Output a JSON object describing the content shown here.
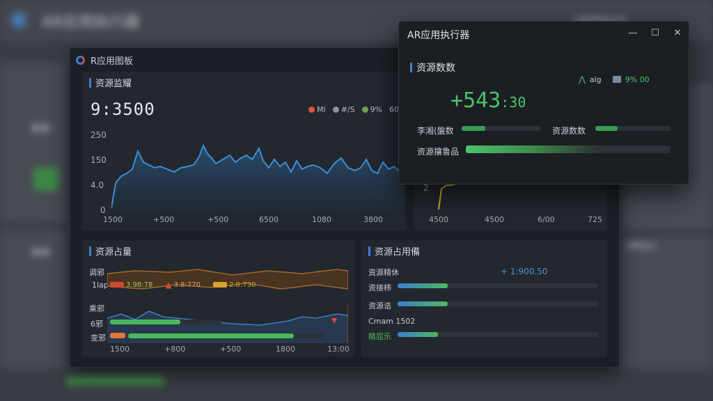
{
  "background": {
    "app_title": "AR应用执行器",
    "right_label": "l4BB8m0",
    "side_label_1": "量量",
    "side_label_2": "量量",
    "right_text": "H8Sa•"
  },
  "dashboard": {
    "title": "R应用图板",
    "monitor": {
      "title": "资源监耀",
      "value": "9:3500",
      "legend": [
        {
          "label": "Ml",
          "color": "#e0553c"
        },
        {
          "label": "#/S",
          "color": "#8e949c"
        },
        {
          "label": "9%",
          "color": "#6aa84f"
        },
        {
          "label": "60",
          "color": "#b0b4ba"
        }
      ],
      "y_ticks": [
        "250",
        "150",
        "4.0",
        "0"
      ],
      "x_ticks": [
        "1500",
        "+500",
        "+500",
        "6500",
        "1080",
        "3800"
      ]
    },
    "mini_chart": {
      "y_tick": "2",
      "x_ticks": [
        "4500",
        "4500",
        "6/00",
        "725"
      ]
    },
    "usage": {
      "title": "资源占量",
      "row1_label": "调邪",
      "row2_label": "1lap",
      "tags": [
        {
          "label": "3.98:78",
          "color": "#d04a2a"
        },
        {
          "label": "3.8:770",
          "color": "#d04a2a"
        },
        {
          "label": "2.8:730",
          "color": "#d9a228"
        }
      ],
      "row3_label": "乘邪",
      "row4_label": "6邪",
      "row5_label": "变邪",
      "x_ticks": [
        "1500",
        "+800",
        "+500",
        "1800",
        "13:00"
      ],
      "bars": [
        {
          "value": 0.63,
          "color": "#4cb85c"
        },
        {
          "value": 0.85,
          "color": "#4cb85c"
        }
      ]
    },
    "occupancy": {
      "title": "资源占用備",
      "header_label": "资源精休",
      "header_value": "+ 1:900.50",
      "rows": [
        {
          "label": "资接柿",
          "fill": 0.25
        },
        {
          "label": "资源诰",
          "fill": 0.25
        },
        {
          "label": "Cmam 1502",
          "fill": 0
        },
        {
          "label": "睛屈乐",
          "fill": 0.2
        }
      ]
    }
  },
  "popup": {
    "title": "AR应用执行器",
    "minimize": "—",
    "maximize": "☐",
    "close": "✕",
    "section": "资源数数",
    "indicator1": "alg",
    "indicator2": "9% 00",
    "value_main": "+543",
    "value_small": ":30",
    "row1_label": "李湘(盤数",
    "row1_fill": 0.3,
    "row2_label": "资源数数",
    "row2_fill": 0.3,
    "row3_label": "资源攘鲁品",
    "row3_fill": 0.65,
    "colors": {
      "accent": "#4cc46a",
      "track": "#2c3037"
    }
  }
}
